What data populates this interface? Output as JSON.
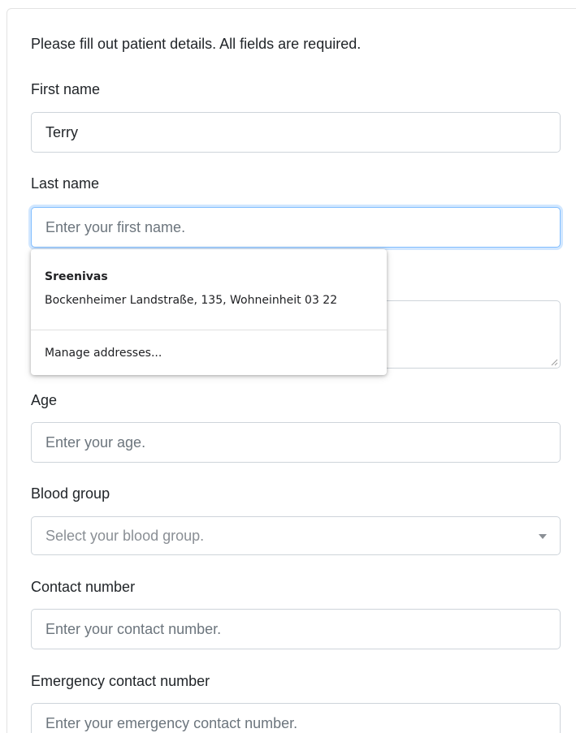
{
  "form": {
    "intro": "Please fill out patient details. All fields are required.",
    "first_name": {
      "label": "First name",
      "value": "Terry"
    },
    "last_name": {
      "label": "Last name",
      "placeholder": "Enter your first name."
    },
    "age": {
      "label": "Age",
      "placeholder": "Enter your age."
    },
    "blood_group": {
      "label": "Blood group",
      "placeholder": "Select your blood group."
    },
    "contact_number": {
      "label": "Contact number",
      "placeholder": "Enter your contact number."
    },
    "emergency_contact": {
      "label": "Emergency contact number",
      "placeholder": "Enter your emergency contact number."
    }
  },
  "autocomplete": {
    "suggestion": {
      "name": "Sreenivas",
      "address": "Bockenheimer Landstraße, 135, Wohneinheit 03 22"
    },
    "manage_label": "Manage addresses..."
  },
  "colors": {
    "focus_border": "#80bdff",
    "field_border": "#ced4da",
    "placeholder": "#6c757d",
    "text": "#212529"
  }
}
